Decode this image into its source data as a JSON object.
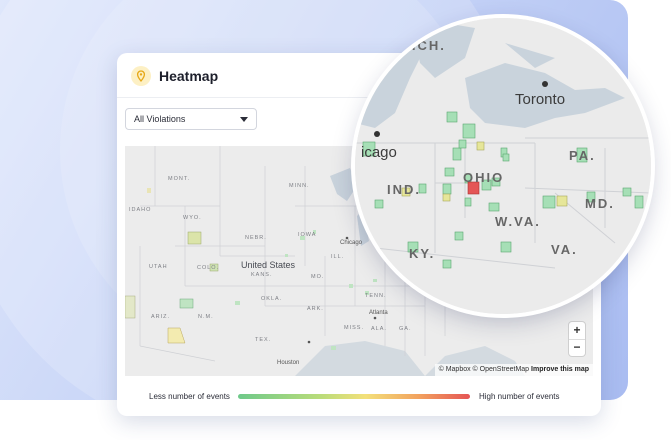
{
  "title": "Heatmap",
  "filter": {
    "selected": "All Violations"
  },
  "map": {
    "country_label": "United States",
    "state_labels": [
      "MONT.",
      "IDAHO",
      "WYO.",
      "NEBR.",
      "UTAH",
      "COLO.",
      "KANS.",
      "MINN.",
      "IOWA",
      "ILL.",
      "MO.",
      "ARIZ.",
      "N.M.",
      "OKLA.",
      "ARK.",
      "TEX.",
      "MISS.",
      "ALA.",
      "GA.",
      "TENN."
    ],
    "city_labels": [
      "Chicago",
      "Atlanta",
      "Houston"
    ],
    "zoom_in": "+",
    "zoom_out": "−",
    "attribution_prefix": "© Mapbox © OpenStreetMap",
    "attribution_link": "Improve this map"
  },
  "magnifier": {
    "city_labels": [
      "Toronto",
      "icago"
    ],
    "state_labels": [
      "MICH.",
      "OHIO",
      "IND.",
      "PA.",
      "W.VA.",
      "MD.",
      "KY.",
      "VA."
    ]
  },
  "legend": {
    "low_label": "Less number of events",
    "high_label": "High number of events"
  },
  "colors": {
    "low": "#6ec98a",
    "mid": "#f3e07a",
    "high": "#e55555",
    "brand_icon_bg": "#fdf0c4",
    "brand_icon": "#e6a817"
  }
}
